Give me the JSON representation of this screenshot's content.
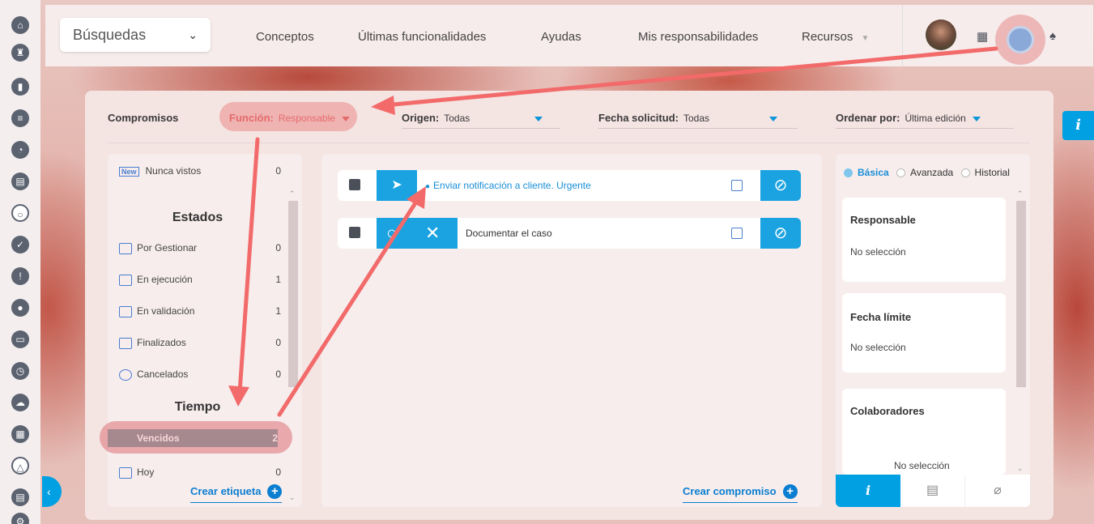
{
  "topbar": {
    "search_select": "Búsquedas",
    "nav": [
      "Conceptos",
      "Últimas funcionalidades",
      "Ayudas",
      "Mis responsabilidades",
      "Recursos"
    ]
  },
  "filters": {
    "title": "Compromisos",
    "funcion_label": "Función:",
    "funcion_value": "Responsable",
    "origen_label": "Origen:",
    "origen_value": "Todas",
    "fecha_label": "Fecha solicitud:",
    "fecha_value": "Todas",
    "ordenar_label": "Ordenar por:",
    "ordenar_value": "Última edición"
  },
  "left": {
    "new_badge": "New",
    "nunca_vistos": {
      "label": "Nunca vistos",
      "count": "0"
    },
    "estados_title": "Estados",
    "estados": [
      {
        "label": "Por Gestionar",
        "count": "0"
      },
      {
        "label": "En ejecución",
        "count": "1"
      },
      {
        "label": "En validación",
        "count": "1"
      },
      {
        "label": "Finalizados",
        "count": "0"
      },
      {
        "label": "Cancelados",
        "count": "0"
      }
    ],
    "tiempo_title": "Tiempo",
    "tiempo": [
      {
        "label": "Vencidos",
        "count": "2"
      },
      {
        "label": "Hoy",
        "count": "0"
      }
    ],
    "crear_etiqueta": "Crear etiqueta"
  },
  "center": {
    "tasks": [
      {
        "title": "Enviar notificación a cliente. Urgente"
      },
      {
        "title": "Documentar el caso"
      }
    ],
    "crear_compromiso": "Crear compromiso"
  },
  "right": {
    "radios": [
      "Básica",
      "Avanzada",
      "Historial"
    ],
    "cards": [
      {
        "title": "Responsable",
        "value": "No selección"
      },
      {
        "title": "Fecha límite",
        "value": "No selección"
      },
      {
        "title": "Colaboradores",
        "value": "No selección"
      }
    ],
    "tabs": [
      "i",
      "comment-icon",
      "attach-icon"
    ]
  },
  "colors": {
    "accent": "#00a0e3",
    "link": "#0a7ed0",
    "highlight": "#e8787c"
  }
}
